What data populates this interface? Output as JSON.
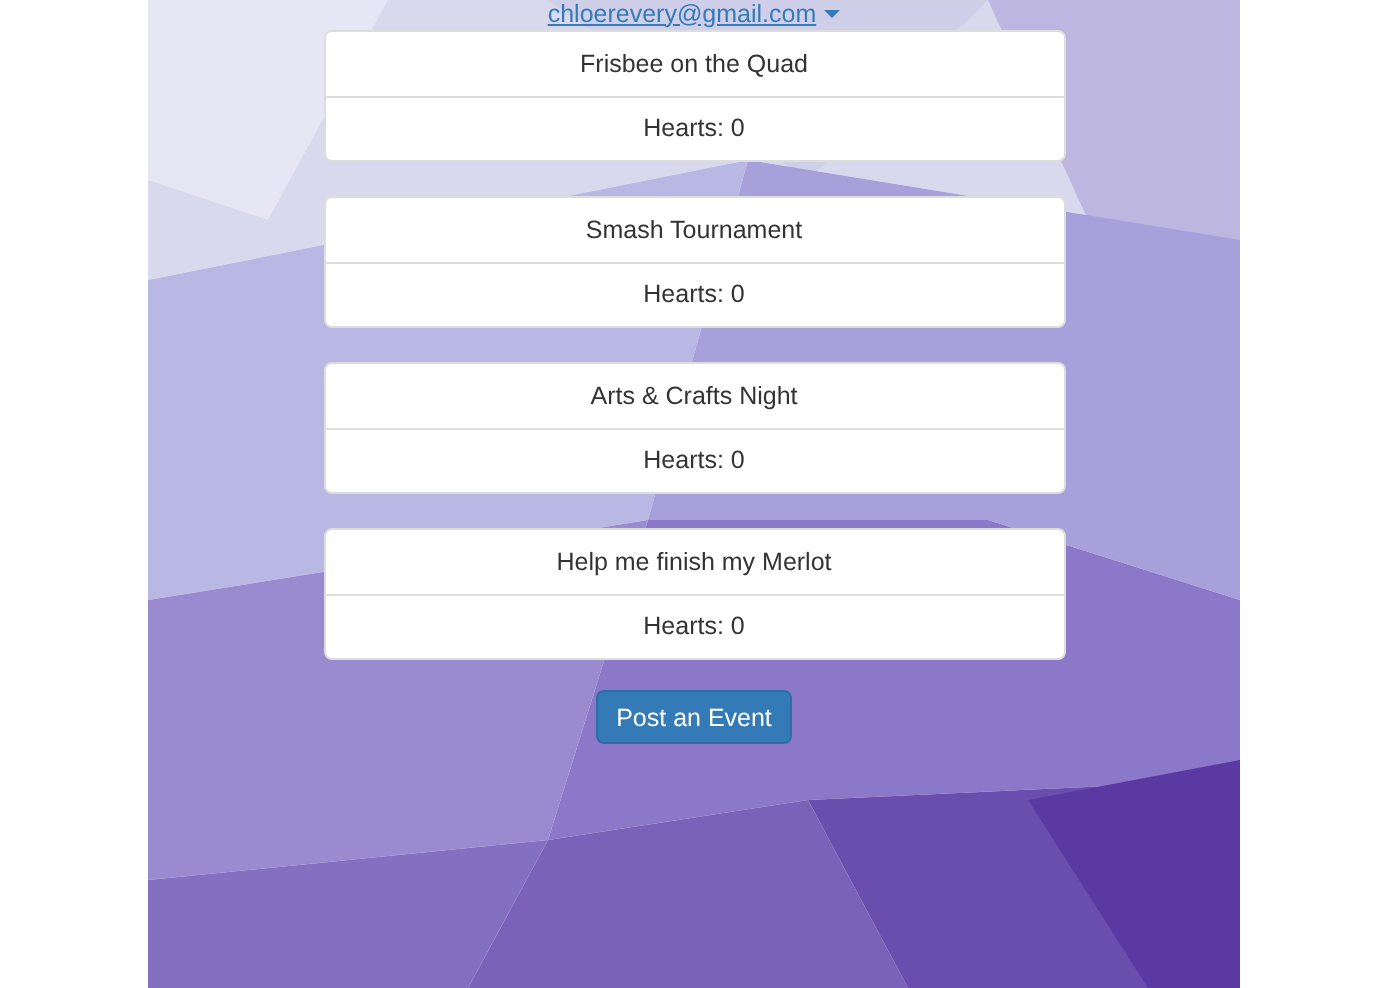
{
  "account": {
    "email": "chloerevery@gmail.com"
  },
  "events": [
    {
      "title": "Frisbee on the Quad",
      "hearts": "Hearts: 0"
    },
    {
      "title": "Smash Tournament",
      "hearts": "Hearts: 0"
    },
    {
      "title": "Arts & Crafts Night",
      "hearts": "Hearts: 0"
    },
    {
      "title": "Help me finish my Merlot",
      "hearts": "Hearts: 0"
    }
  ],
  "post_button": "Post an Event"
}
